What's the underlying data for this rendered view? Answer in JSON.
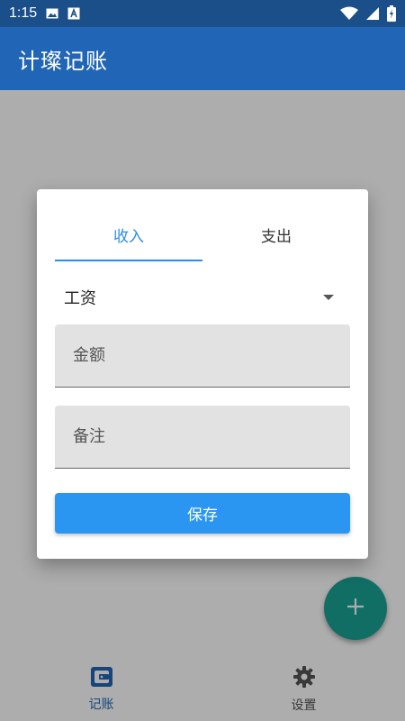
{
  "status_bar": {
    "time": "1:15",
    "icons": [
      "image-icon",
      "a-badge-icon",
      "wifi-icon",
      "signal-icon",
      "battery-icon"
    ]
  },
  "app_bar": {
    "title": "计璨记账"
  },
  "bottom_nav": {
    "items": [
      {
        "label": "记账",
        "icon": "wallet-icon",
        "active": true
      },
      {
        "label": "设置",
        "icon": "gear-icon",
        "active": false
      }
    ]
  },
  "fab": {
    "icon": "plus-icon",
    "color": "#1aa394"
  },
  "dialog": {
    "tabs": [
      {
        "label": "收入",
        "active": true
      },
      {
        "label": "支出",
        "active": false
      }
    ],
    "category": {
      "selected": "工资"
    },
    "amount_field": {
      "placeholder": "金额",
      "value": ""
    },
    "note_field": {
      "placeholder": "备注",
      "value": ""
    },
    "save_label": "保存"
  },
  "colors": {
    "status_bar": "#1a4f8a",
    "app_bar": "#2166b6",
    "accent": "#2b8ee8",
    "save_button": "#2a96f1",
    "fab": "#1aa394"
  }
}
